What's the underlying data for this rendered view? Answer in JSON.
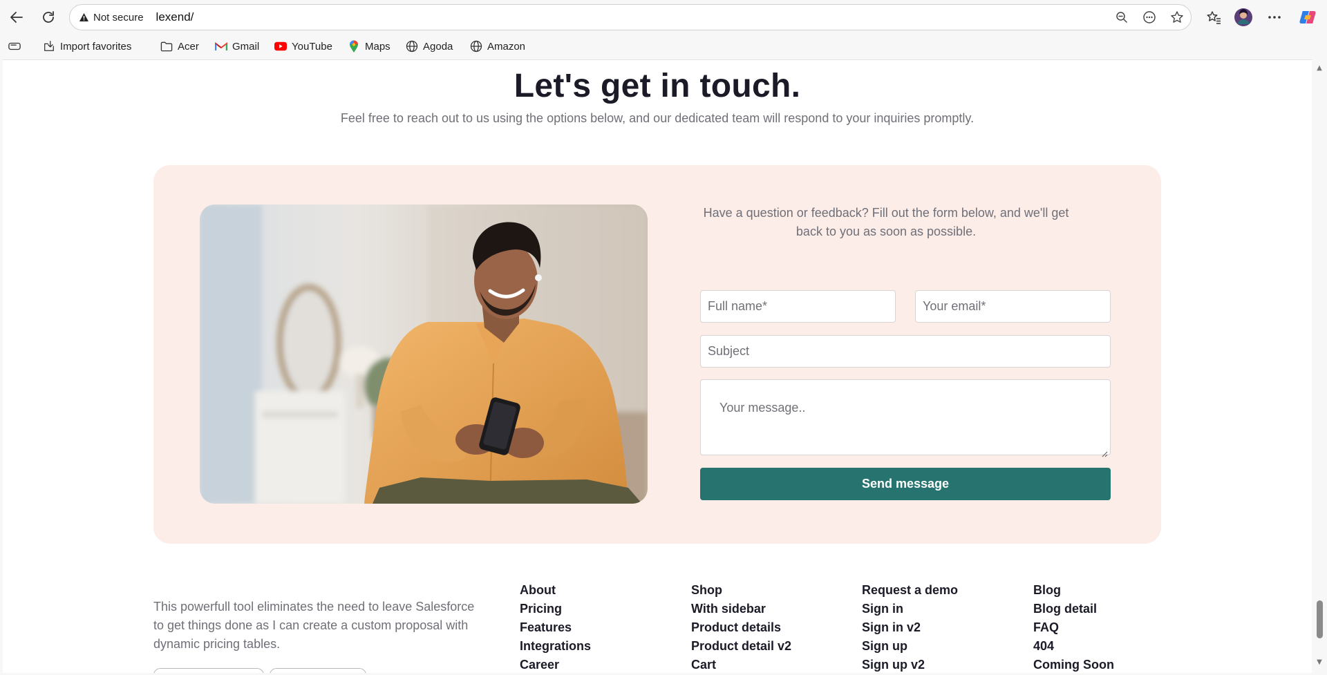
{
  "browser": {
    "security_label": "Not secure",
    "url": "lexend/",
    "bookmarks": [
      {
        "label": "",
        "icon": "tab-actions-icon"
      },
      {
        "label": "Import favorites",
        "icon": "import-icon"
      },
      {
        "label": "Acer",
        "icon": "folder-icon"
      },
      {
        "label": "Gmail",
        "icon": "gmail-icon"
      },
      {
        "label": "YouTube",
        "icon": "youtube-icon"
      },
      {
        "label": "Maps",
        "icon": "maps-icon"
      },
      {
        "label": "Agoda",
        "icon": "globe-icon"
      },
      {
        "label": "Amazon",
        "icon": "globe-icon"
      }
    ]
  },
  "hero": {
    "title": "Let's get in touch.",
    "subtitle": "Feel free to reach out to us using the options below, and our dedicated team will respond to your inquiries promptly."
  },
  "contact": {
    "intro": "Have a question or feedback? Fill out the form below, and we'll get back to you as soon as possible.",
    "name_placeholder": "Full name*",
    "email_placeholder": "Your email*",
    "subject_placeholder": "Subject",
    "message_placeholder": "Your message..",
    "send_label": "Send message"
  },
  "footer": {
    "description": "This powerfull tool eliminates the need to leave Salesforce to get things done as I can create a custom proposal with dynamic pricing tables.",
    "columns": [
      [
        "About",
        "Pricing",
        "Features",
        "Integrations",
        "Career"
      ],
      [
        "Shop",
        "With sidebar",
        "Product details",
        "Product detail v2",
        "Cart"
      ],
      [
        "Request a demo",
        "Sign in",
        "Sign in v2",
        "Sign up",
        "Sign up v2"
      ],
      [
        "Blog",
        "Blog detail",
        "FAQ",
        "404",
        "Coming Soon"
      ]
    ]
  },
  "colors": {
    "accent": "#267370",
    "card_bg": "#fcede8",
    "heading": "#1b1b28",
    "muted": "#6f6f78"
  }
}
